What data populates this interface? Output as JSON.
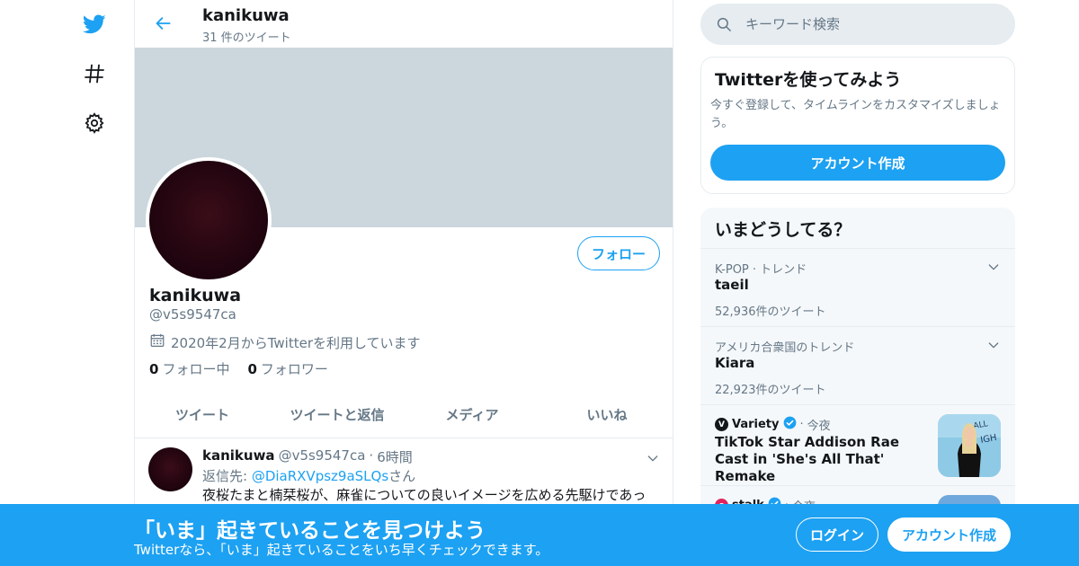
{
  "nav": {
    "icons": [
      "twitter-bird-icon",
      "hashtag-icon",
      "gear-icon"
    ]
  },
  "header": {
    "name": "kanikuwa",
    "tweet_count": "31 件のツイート"
  },
  "profile": {
    "name": "kanikuwa",
    "handle": "@v5s9547ca",
    "joined": "2020年2月からTwitterを利用しています",
    "following_count": "0",
    "following_label": "フォロー中",
    "followers_count": "0",
    "followers_label": "フォロワー",
    "follow_button": "フォロー"
  },
  "tabs": [
    "ツイート",
    "ツイートと返信",
    "メディア",
    "いいね"
  ],
  "tweet": {
    "name": "kanikuwa",
    "handle": "@v5s9547ca",
    "dot": "·",
    "time": "6時間",
    "reply_prefix": "返信先: ",
    "reply_handle": "@DiaRXVpsz9aSLQs",
    "reply_suffix": "さん",
    "text": "夜桜たまと楠栞桜が、麻雀についての良いイメージを広める先駆けであっ"
  },
  "search": {
    "placeholder": "キーワード検索"
  },
  "signup_card": {
    "title": "Twitterを使ってみよう",
    "description": "今すぐ登録して、タイムラインをカスタマイズしましょう。",
    "button": "アカウント作成"
  },
  "trends": {
    "title": "いまどうしてる？",
    "items": [
      {
        "meta": "K-POP · トレンド",
        "name": "taeil",
        "count": "52,936件のツイート"
      },
      {
        "meta": "アメリカ合衆国のトレンド",
        "name": "Kiara",
        "count": "22,923件のツイート"
      }
    ],
    "news": [
      {
        "source": "Variety",
        "time": "今夜",
        "title": "TikTok Star Addison Rae Cast in 'She's All That' Remake"
      },
      {
        "source": "stalk",
        "time": "今夜",
        "title": ""
      }
    ]
  },
  "bottom_bar": {
    "title": "「いま」起きていることを見つけよう",
    "subtitle": "Twitterなら、「いま」起きていることをいち早くチェックできます。",
    "login": "ログイン",
    "signup": "アカウント作成"
  },
  "colors": {
    "accent": "#1da1f2",
    "banner": "#ccd6dd",
    "muted_text": "#657786",
    "trends_bg": "#f5f8fa"
  }
}
